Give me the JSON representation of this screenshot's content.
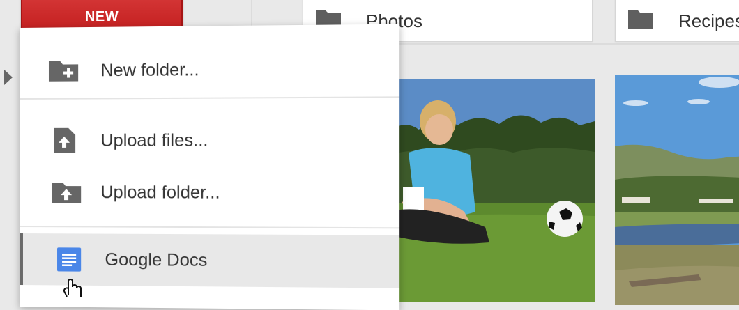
{
  "new_button": {
    "label": "NEW"
  },
  "folders": [
    {
      "name": "Photos"
    },
    {
      "name": "Recipes"
    }
  ],
  "menu": {
    "items": [
      {
        "label": "New folder...",
        "icon": "folder-plus-icon"
      },
      {
        "label": "Upload files...",
        "icon": "file-upload-icon"
      },
      {
        "label": "Upload folder...",
        "icon": "folder-upload-icon"
      },
      {
        "label": "Google Docs",
        "icon": "google-docs-icon",
        "state": "hovered"
      }
    ]
  },
  "thumbnails": [
    {
      "subject": "boy-with-soccer-ball-photo"
    },
    {
      "subject": "lake-landscape-photo"
    }
  ],
  "colors": {
    "new_button": "#cc2a2a",
    "docs_blue": "#4a86e8",
    "icon_gray": "#666666",
    "hover_bg": "#e8e8e8"
  }
}
